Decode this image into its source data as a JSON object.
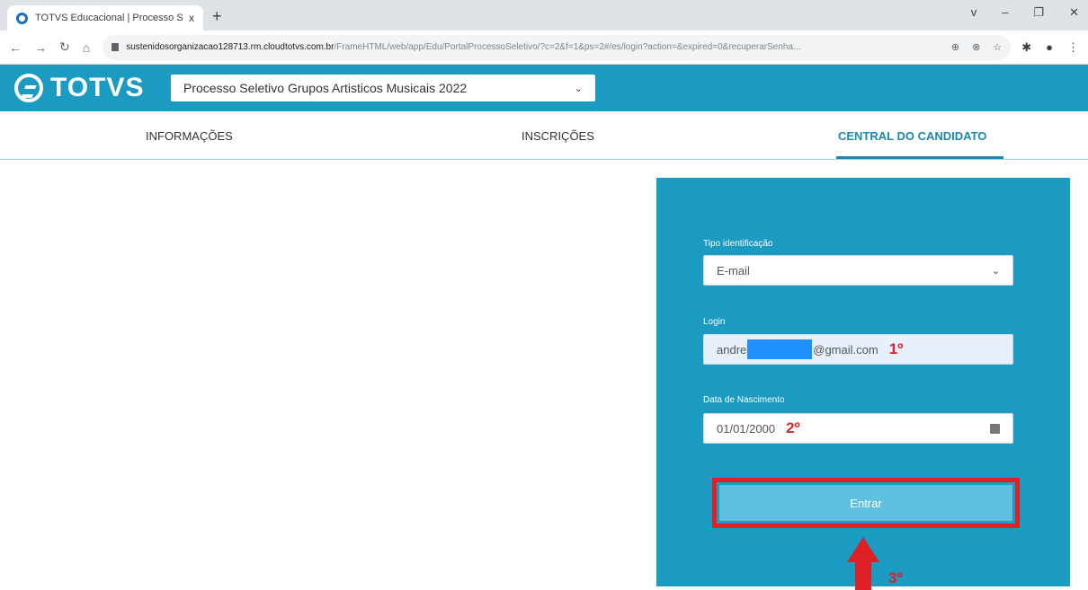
{
  "browser": {
    "tab_title": "TOTVS Educacional | Processo S...",
    "tab_close": "x",
    "new_tab": "+",
    "url_host": "sustenidosorganizacao128713.rm.cloudtotvs.com.br",
    "url_path": "/FrameHTML/web/app/Edu/PortalProcessoSeletivo/?c=2&f=1&ps=2#/es/login?action=&expired=0&recuperarSenha...",
    "window_controls": [
      "v",
      "–",
      "❐",
      "✕"
    ]
  },
  "header": {
    "logo_text": "TOTVS",
    "process_select_value": "Processo Seletivo Grupos Artisticos Musicais 2022"
  },
  "nav": {
    "tabs": [
      "INFORMAÇÕES",
      "INSCRIÇÕES",
      "CENTRAL DO CANDIDATO"
    ]
  },
  "login": {
    "id_type_label": "Tipo identificação",
    "id_type_value": "E-mail",
    "login_label": "Login",
    "login_value_start": "andre",
    "login_value_end": "@gmail.com",
    "birth_label": "Data de Nascimento",
    "birth_value": "01/01/2000",
    "submit_label": "Entrar"
  },
  "annotations": {
    "step1": "1º",
    "step2": "2º",
    "step3": "3º"
  },
  "colors": {
    "brand": "#1b9ac2",
    "annotation_red": "#e01f26",
    "button": "#5fc0e0"
  }
}
